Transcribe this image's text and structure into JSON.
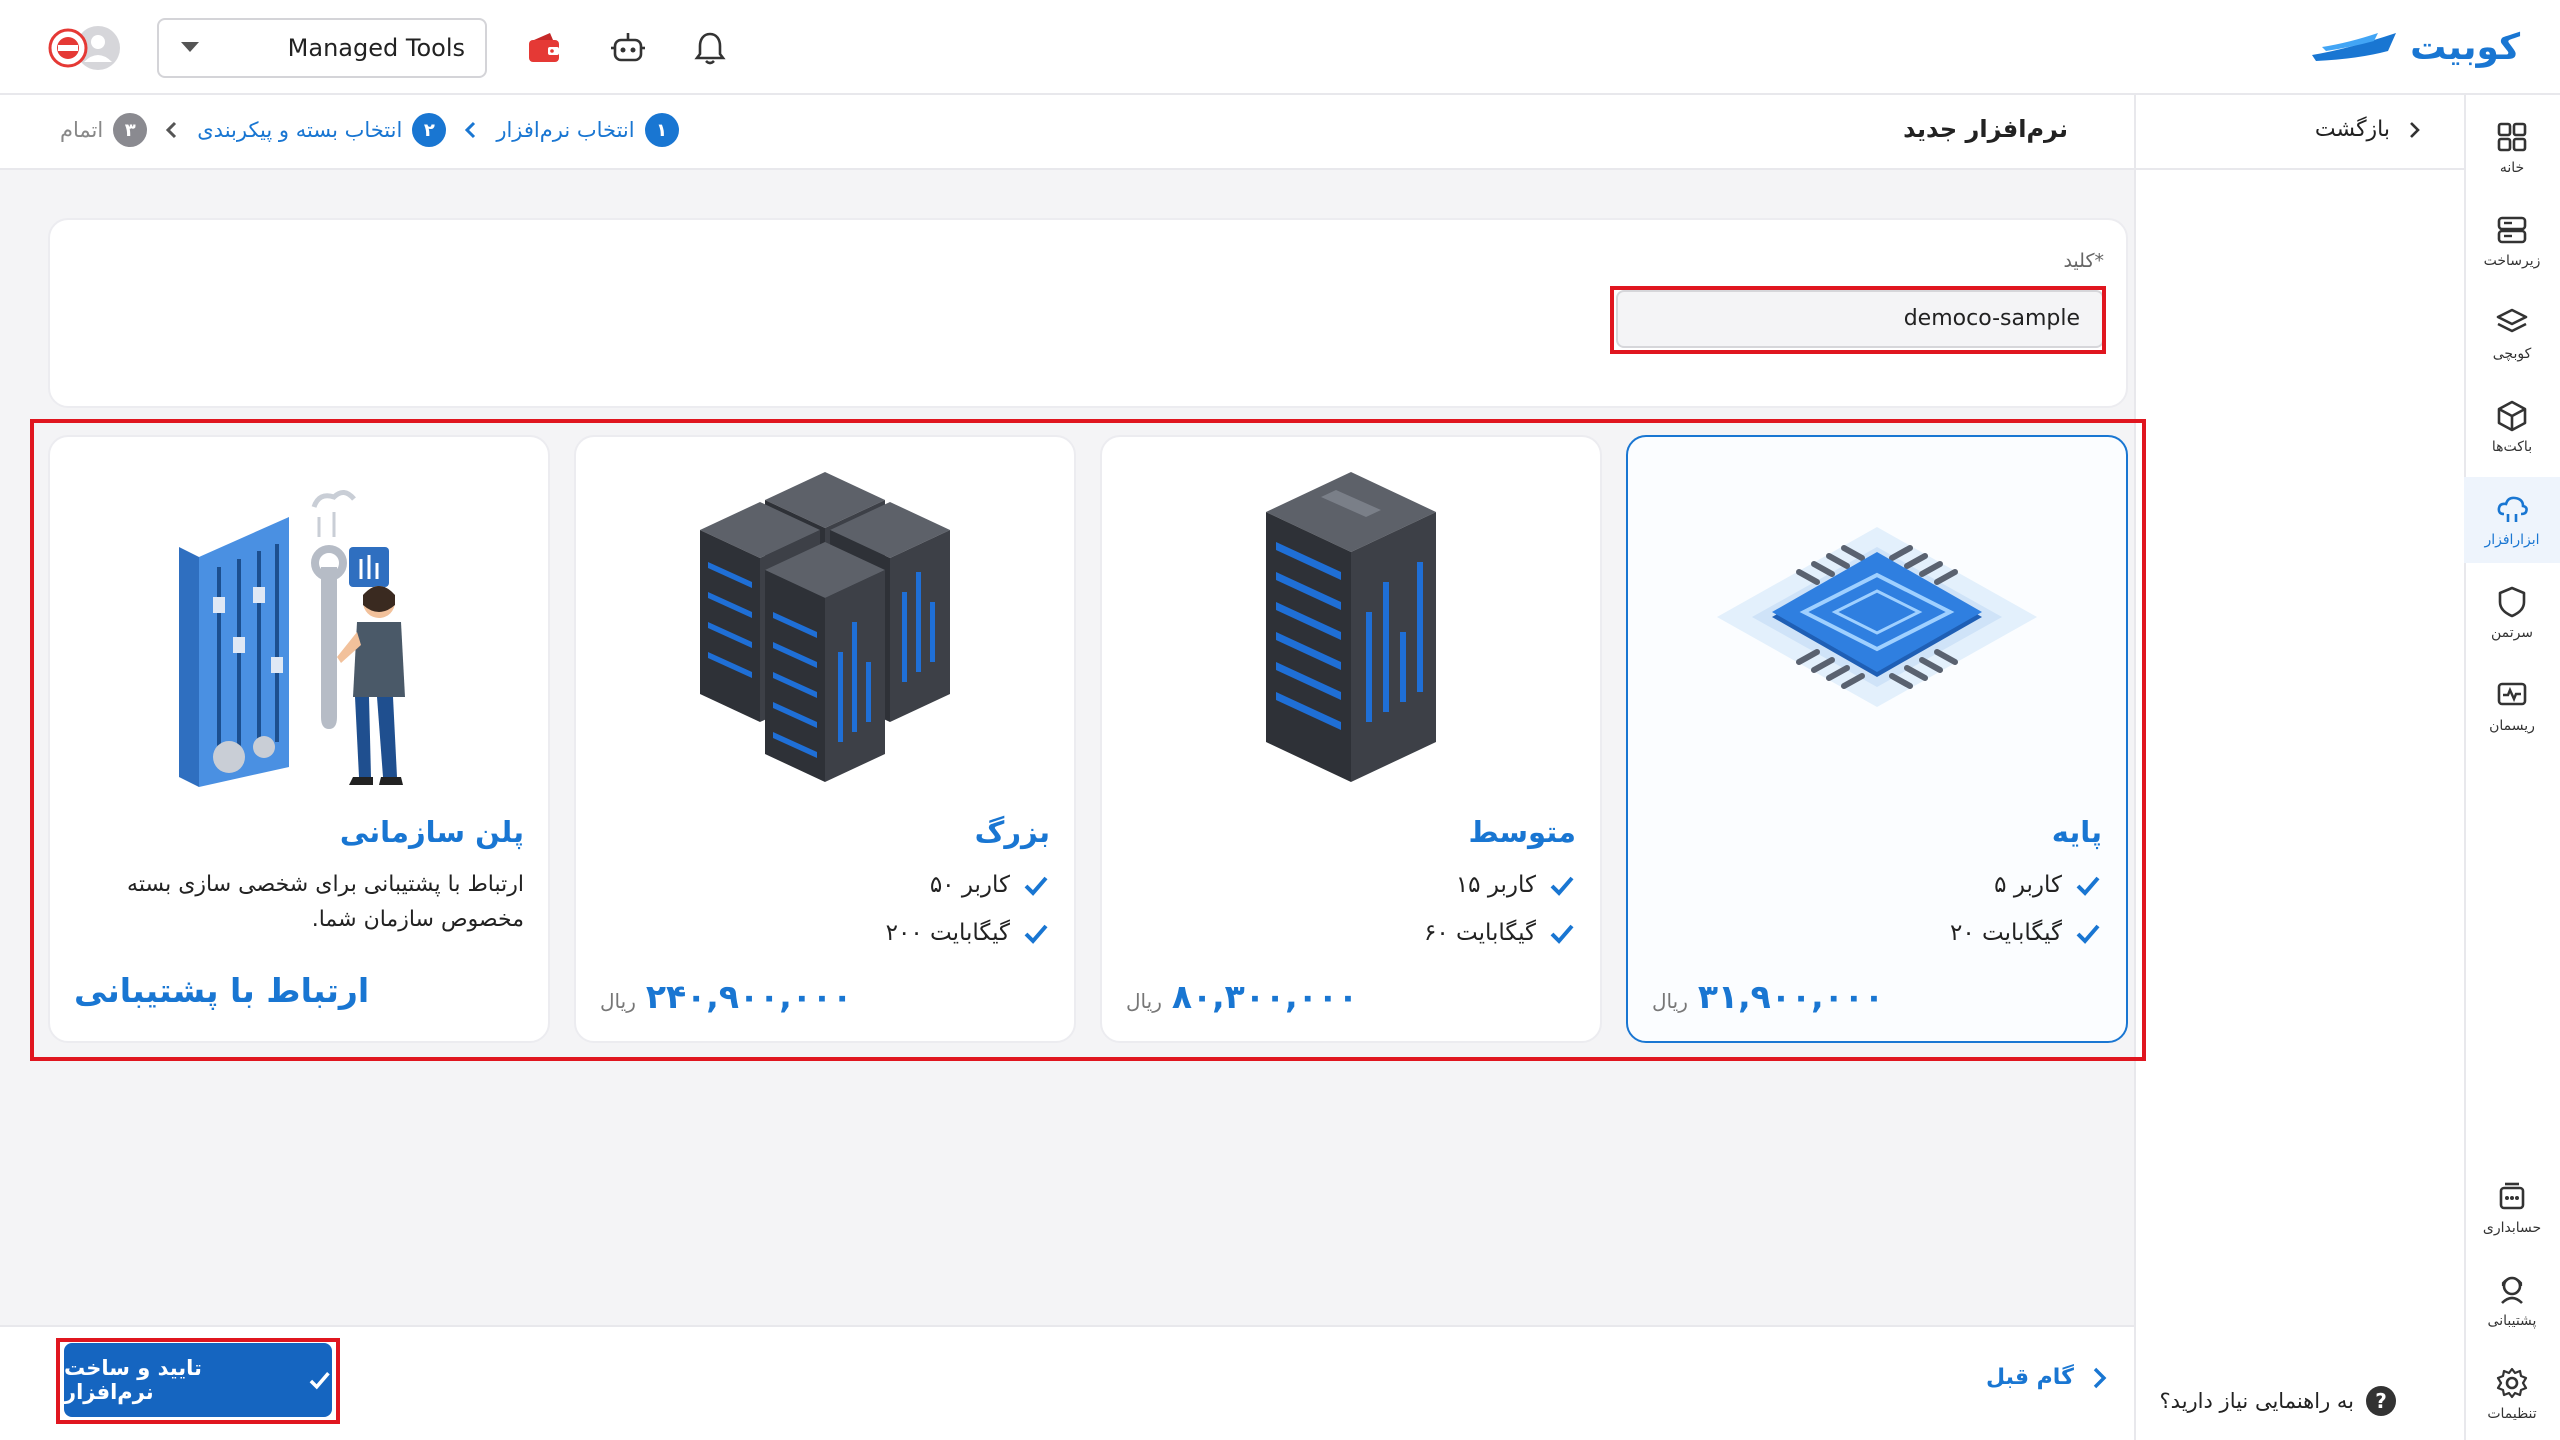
{
  "brand": {
    "name": "کوبیت",
    "color": "#1976d2"
  },
  "header": {
    "org_selector": {
      "value": "Managed Tools",
      "icon": "chevron-down-icon"
    },
    "icons": [
      "wallet-icon",
      "robot-icon",
      "bell-icon"
    ],
    "avatar_icon": "user-avatar-icon"
  },
  "sidebar": {
    "items": [
      {
        "label": "خانه",
        "icon": "grid-icon",
        "active": false
      },
      {
        "label": "زیرساخت",
        "icon": "server-stack-icon",
        "active": false
      },
      {
        "label": "کوبچی",
        "icon": "layers-icon",
        "active": false
      },
      {
        "label": "باکت‌ها",
        "icon": "box-icon",
        "active": false
      },
      {
        "label": "ابزارافزار",
        "icon": "cloud-tools-icon",
        "active": true
      },
      {
        "label": "سرتمن",
        "icon": "shield-icon",
        "active": false
      },
      {
        "label": "ریسمان",
        "icon": "monitor-pulse-icon",
        "active": false
      },
      {
        "label": "حسابداری",
        "icon": "calculator-icon",
        "active": false
      },
      {
        "label": "پشتیبانی",
        "icon": "support-icon",
        "active": false
      },
      {
        "label": "تنظیمات",
        "icon": "gear-icon",
        "active": false
      }
    ]
  },
  "back_panel": {
    "back_label": "بازگشت",
    "help_label": "به راهنمایی نیاز دارید؟",
    "help_glyph": "?"
  },
  "page": {
    "title": "نرم‌افزار جدید",
    "steps": [
      {
        "num": "۱",
        "label": "انتخاب نرم‌افزار",
        "state": "done"
      },
      {
        "num": "۲",
        "label": "انتخاب بسته و پیکربندی",
        "state": "done"
      },
      {
        "num": "۳",
        "label": "اتمام",
        "state": "pending"
      }
    ]
  },
  "key_field": {
    "label": "کلید*",
    "value": "democo-sample"
  },
  "plans": [
    {
      "name": "پایه",
      "features": [
        "۵ کاربر",
        "۲۰ گیگابایت"
      ],
      "price": "۳۱,۹۰۰,۰۰۰",
      "unit": "ریال",
      "selected": true,
      "art": "chip-icon"
    },
    {
      "name": "متوسط",
      "features": [
        "۱۵ کاربر",
        "۶۰ گیگابایت"
      ],
      "price": "۸۰,۳۰۰,۰۰۰",
      "unit": "ریال",
      "selected": false,
      "art": "server-rack-icon"
    },
    {
      "name": "بزرگ",
      "features": [
        "۵۰ کاربر",
        "۲۰۰ گیگابایت"
      ],
      "price": "۲۴۰,۹۰۰,۰۰۰",
      "unit": "ریال",
      "selected": false,
      "art": "server-cluster-icon"
    },
    {
      "name": "پلن سازمانی",
      "description": "ارتباط با پشتیبانی برای شخصی سازی بسته مخصوص سازمان شما.",
      "cta": "ارتباط با پشتیبانی",
      "selected": false,
      "art": "engineer-tools-icon"
    }
  ],
  "footer": {
    "confirm_label": "تایید و ساخت نرم‌افزار",
    "prev_label": "گام قبل"
  },
  "colors": {
    "accent": "#1976d2",
    "highlight": "#e0161f",
    "wallet": "#e53935"
  }
}
